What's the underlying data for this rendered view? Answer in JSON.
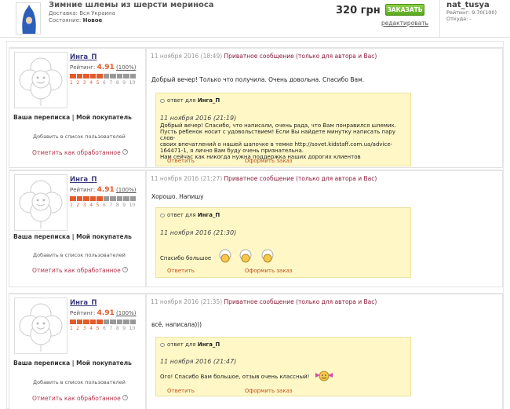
{
  "product": {
    "title": "Зимние шлемы из шерсти мериноса",
    "delivery_label": "Доставка:",
    "delivery_value": "Вся Украина",
    "condition_label": "Состояние:",
    "condition_value": "Новое",
    "price": "320 грн",
    "order_label": "ЗАКАЗАТЬ",
    "edit_label": "редактировать"
  },
  "seller": {
    "name": "nat_tusya",
    "rating": "Рейтинг: 9.70(100)",
    "from": "Откуда: -"
  },
  "colors": {
    "accent_green": "#6bbb2e",
    "rating_orange": "#e35b2a",
    "reply_bg": "#fff8c6",
    "private_link": "#8a1a3a",
    "action_link": "#c0501d"
  },
  "messages": [
    {
      "user": "Инга_П",
      "rating_label": "Рейтинг:",
      "rating_value": "4.91",
      "rating_pct": "(100%)",
      "rating_scale": [
        "1",
        "2",
        "3",
        "4",
        "5",
        "6",
        "7",
        "8",
        "9",
        "10"
      ],
      "correspondence": "Ваша переписка | Мой покупатель",
      "add_to_list": "Добавить в список пользователей",
      "mark_processed": "Отметить как обработанное",
      "date": "11 ноября 2016 (18:49)",
      "private": "Приватное сообщение (только для автора и Вас)",
      "text": "Добрый вечер! Только что получила. Очень довольна. Спасибо Вам.",
      "reply": {
        "to_label": "ответ для",
        "to_user": "Инга_П",
        "date": "11 ноября 2016 (21:19)",
        "lines": [
          "Добрый вечер! Спасибо, что написали, очень рада, что Вам понравился шлемик.",
          "Пусть ребенок носит с удовольствием! Если Вы найдете минутку написать пару слов-",
          "своих впечатлений о нашей шапочке в темке http://sovet.kidstaff.com.ua/advice-",
          "164471-1, я лично Вам буду очень признательна.",
          "Нам сейчас как никогда нужна поддержка наших дорогих клиентов"
        ],
        "answer": "Ответить",
        "make_order": "Оформить заказ"
      }
    },
    {
      "user": "Инга_П",
      "rating_label": "Рейтинг:",
      "rating_value": "4.91",
      "rating_pct": "(100%)",
      "rating_scale": [
        "1",
        "2",
        "3",
        "4",
        "5",
        "6",
        "7",
        "8",
        "9",
        "10"
      ],
      "correspondence": "Ваша переписка | Мой покупатель",
      "add_to_list": "Добавить в список пользователей",
      "mark_processed": "Отметить как обработанное",
      "date": "11 ноября 2016 (21:27)",
      "private": "Приватное сообщение (только для автора и Вас)",
      "text": "Хорошо. Напишу",
      "reply": {
        "to_label": "ответ для",
        "to_user": "Инга_П",
        "date": "11 ноября 2016 (21:30)",
        "lines": [
          "Спасибо большое"
        ],
        "answer": "Ответить",
        "make_order": "Оформить заказ"
      }
    },
    {
      "user": "Инга_П",
      "rating_label": "Рейтинг:",
      "rating_value": "4.91",
      "rating_pct": "(100%)",
      "rating_scale": [
        "1",
        "2",
        "3",
        "4",
        "5",
        "6",
        "7",
        "8",
        "9",
        "10"
      ],
      "correspondence": "Ваша переписка | Мой покупатель",
      "add_to_list": "Добавить в список пользователей",
      "mark_processed": "Отметить как обработанное",
      "date": "11 ноября 2016 (21:35)",
      "private": "Приватное сообщение (только для автора и Вас)",
      "text": "всё, написала)))",
      "reply": {
        "to_label": "ответ для",
        "to_user": "Инга_П",
        "date": "11 ноября 2016 (21:47)",
        "lines": [
          "Ого! Спасибо Вам большое, отзыв очень классный!"
        ],
        "answer": "Ответить",
        "make_order": "Оформить заказ"
      }
    }
  ]
}
